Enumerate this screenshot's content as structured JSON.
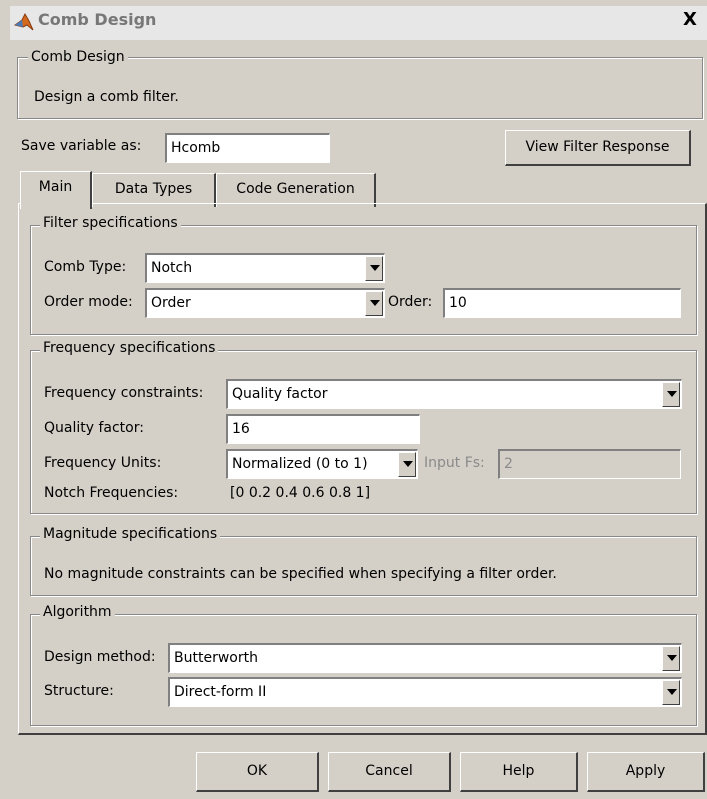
{
  "window": {
    "title": "Comb Design",
    "close_symbol": "X"
  },
  "header_group": {
    "label": "Comb Design",
    "description": "Design a comb filter."
  },
  "save_variable": {
    "label": "Save variable as:",
    "value": "Hcomb"
  },
  "view_filter_button": "View Filter Response",
  "tabs": [
    {
      "label": "Main",
      "active": true
    },
    {
      "label": "Data Types"
    },
    {
      "label": "Code Generation"
    }
  ],
  "filter_spec": {
    "label": "Filter specifications",
    "comb_type": {
      "label": "Comb Type:",
      "value": "Notch"
    },
    "order_mode": {
      "label": "Order mode:",
      "value": "Order"
    },
    "order": {
      "label": "Order:",
      "value": "10"
    }
  },
  "freq_spec": {
    "label": "Frequency specifications",
    "constraints": {
      "label": "Frequency constraints:",
      "value": "Quality factor"
    },
    "quality": {
      "label": "Quality factor:",
      "value": "16"
    },
    "units": {
      "label": "Frequency Units:",
      "value": "Normalized (0 to 1)"
    },
    "input_fs": {
      "label": "Input Fs:",
      "value": "2"
    },
    "notch": {
      "label": "Notch Frequencies:",
      "value": "[0 0.2 0.4 0.6 0.8 1]"
    }
  },
  "mag_spec": {
    "label": "Magnitude specifications",
    "text": "No magnitude constraints can be specified when specifying a filter order."
  },
  "algorithm": {
    "label": "Algorithm",
    "design_method": {
      "label": "Design method:",
      "value": "Butterworth"
    },
    "structure": {
      "label": "Structure:",
      "value": "Direct-form II"
    }
  },
  "buttons": {
    "ok": "OK",
    "cancel": "Cancel",
    "help": "Help",
    "apply": "Apply"
  }
}
